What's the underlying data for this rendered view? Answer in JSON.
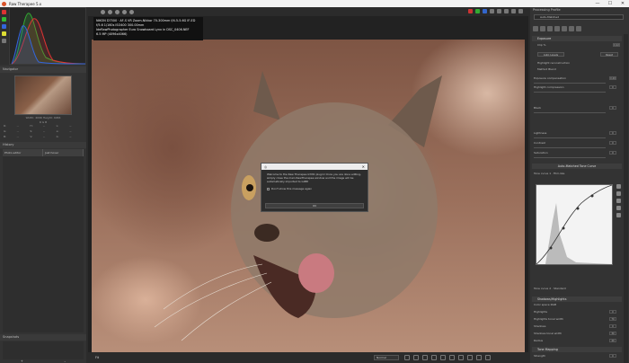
{
  "window": {
    "title": "Raw Therapee 5.x",
    "minimize": "—",
    "maximize": "☐",
    "close": "✕"
  },
  "left": {
    "navigator_label": "Navigator",
    "nav_info": "Width: 4096 Height: 4066",
    "nav_subinfo": "R  G  B",
    "nav_values": [
      "R:",
      "--",
      "H:",
      "--",
      "L:",
      "--",
      "G:",
      "--",
      "S:",
      "--",
      "a:",
      "--",
      "B:",
      "--",
      "V:",
      "--",
      "b:",
      "--"
    ],
    "history_label": "History",
    "history_cols": [
      "Photo editor",
      "Just hover"
    ],
    "snapshots_label": "Snapshots",
    "snap_add": "+",
    "snap_remove": "–"
  },
  "exif": {
    "line1": "NIKON D7500 · AF-S VR Zoom-Nikkor 70-300mm f/4.5-5.6G IF-ED",
    "line2": "f/5.6   1/160s   ISO400   300.00mm",
    "line3": "IdeRawPhotographer  Euro Snowboard Lynx in DSC_0406.NEF",
    "line4": "6.5 MP  (4096x4066)"
  },
  "dialog": {
    "title": "",
    "close": "✕",
    "text": "Welcome to the Raw Therapee G'MIC plugin! Once you are done editing, simply close the main RawTherapee window and the image will be automatically imported to GIMP.",
    "checkbox": "Don't show this message again",
    "ok": "OK"
  },
  "bottombar": {
    "zoom": "Fit",
    "select": "Normal"
  },
  "right": {
    "profile_header": "Processing Profile",
    "profile_value": "Auto-Matched",
    "exposure": {
      "title": "Exposure",
      "clip_label": "Clip %",
      "clip_value": "0.02",
      "auto_btn": "Auto Levels",
      "reset_btn": "Reset",
      "highlight_recon": "Highlight reconstruction",
      "method_label": "Method",
      "method_value": "Blend",
      "rows": [
        {
          "label": "Exposure compensation",
          "value": "0.00"
        },
        {
          "label": "Highlight compression",
          "value": "0"
        },
        {
          "label": "Black",
          "value": "0"
        },
        {
          "label": "Lightness",
          "value": "0"
        },
        {
          "label": "Contrast",
          "value": "0"
        },
        {
          "label": "Saturation",
          "value": "0"
        }
      ],
      "curve_title": "Auto-Matched Tone Curve",
      "tone_curve_label": "Tone curve 1",
      "tone_curve_mode": "Film-like",
      "tone_curve2_label": "Tone curve 2",
      "tone_curve2_mode": "Standard"
    },
    "shadows": {
      "title": "Shadows/Highlights",
      "color_space_label": "Color space",
      "color_space_value": "RGB",
      "rows": [
        {
          "label": "Highlights",
          "value": "0"
        },
        {
          "label": "Highlights tonal width",
          "value": "70"
        },
        {
          "label": "Shadows",
          "value": "0"
        },
        {
          "label": "Shadows tonal width",
          "value": "30"
        },
        {
          "label": "Radius",
          "value": "40"
        }
      ]
    },
    "tone_mapping": {
      "title": "Tone Mapping",
      "row": {
        "label": "Strength",
        "value": "0"
      }
    }
  }
}
